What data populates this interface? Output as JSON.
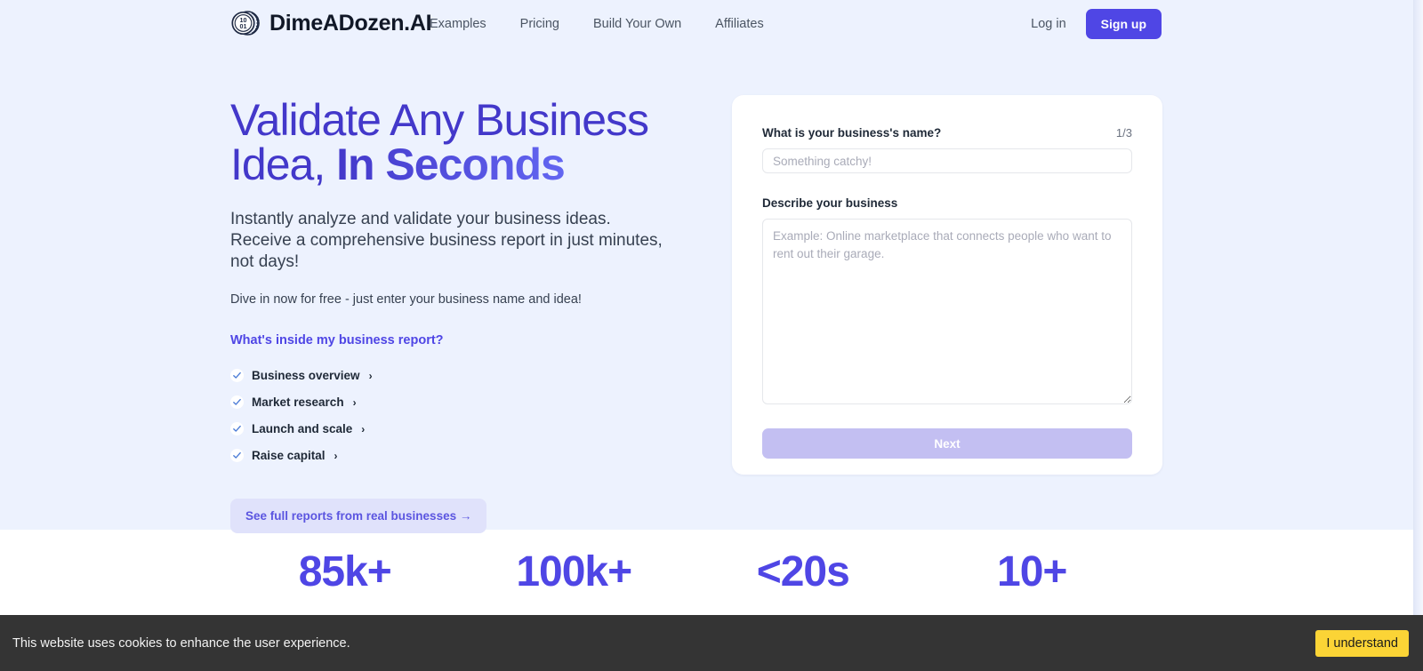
{
  "nav": {
    "brand": "DimeADozen.AI",
    "logo_text_top": "10",
    "logo_text_bottom": "01",
    "links": [
      {
        "label": "Examples"
      },
      {
        "label": "Pricing"
      },
      {
        "label": "Build Your Own"
      },
      {
        "label": "Affiliates"
      }
    ],
    "login_label": "Log in",
    "signup_label": "Sign up"
  },
  "hero": {
    "title_line1": "Validate Any Business",
    "title_line2_regular": "Idea, ",
    "title_line2_strong": "In Seconds",
    "subtitle": "Instantly analyze and validate your business ideas. Receive a comprehensive business report in just minutes, not days!",
    "note": "Dive in now for free - just enter your business name and idea!",
    "inside_title": "What's inside my business report?",
    "features": [
      {
        "label": "Business overview",
        "chevron": "›"
      },
      {
        "label": "Market research",
        "chevron": "›"
      },
      {
        "label": "Launch and scale",
        "chevron": "›"
      },
      {
        "label": "Raise capital",
        "chevron": "›"
      }
    ],
    "reports_button": "See full reports from real businesses →"
  },
  "form": {
    "name_label": "What is your business's name?",
    "step_counter": "1/3",
    "name_placeholder": "Something catchy!",
    "name_value": "",
    "describe_label": "Describe your business",
    "describe_placeholder": "Example: Online marketplace that connects people who want to rent out their garage.",
    "describe_value": "",
    "next_label": "Next"
  },
  "stats": [
    {
      "value": "85k+"
    },
    {
      "value": "100k+"
    },
    {
      "value": "<20s"
    },
    {
      "value": "10+"
    }
  ],
  "cookie": {
    "message": "This website uses cookies to enhance the user experience.",
    "accept_label": "I understand"
  },
  "colors": {
    "accent": "#4f46e5",
    "hero_bg": "#edf2fe",
    "heading": "#4338ca",
    "cookie_bg": "#343434",
    "cookie_button": "#fbd436",
    "next_disabled": "#c3bff2"
  }
}
